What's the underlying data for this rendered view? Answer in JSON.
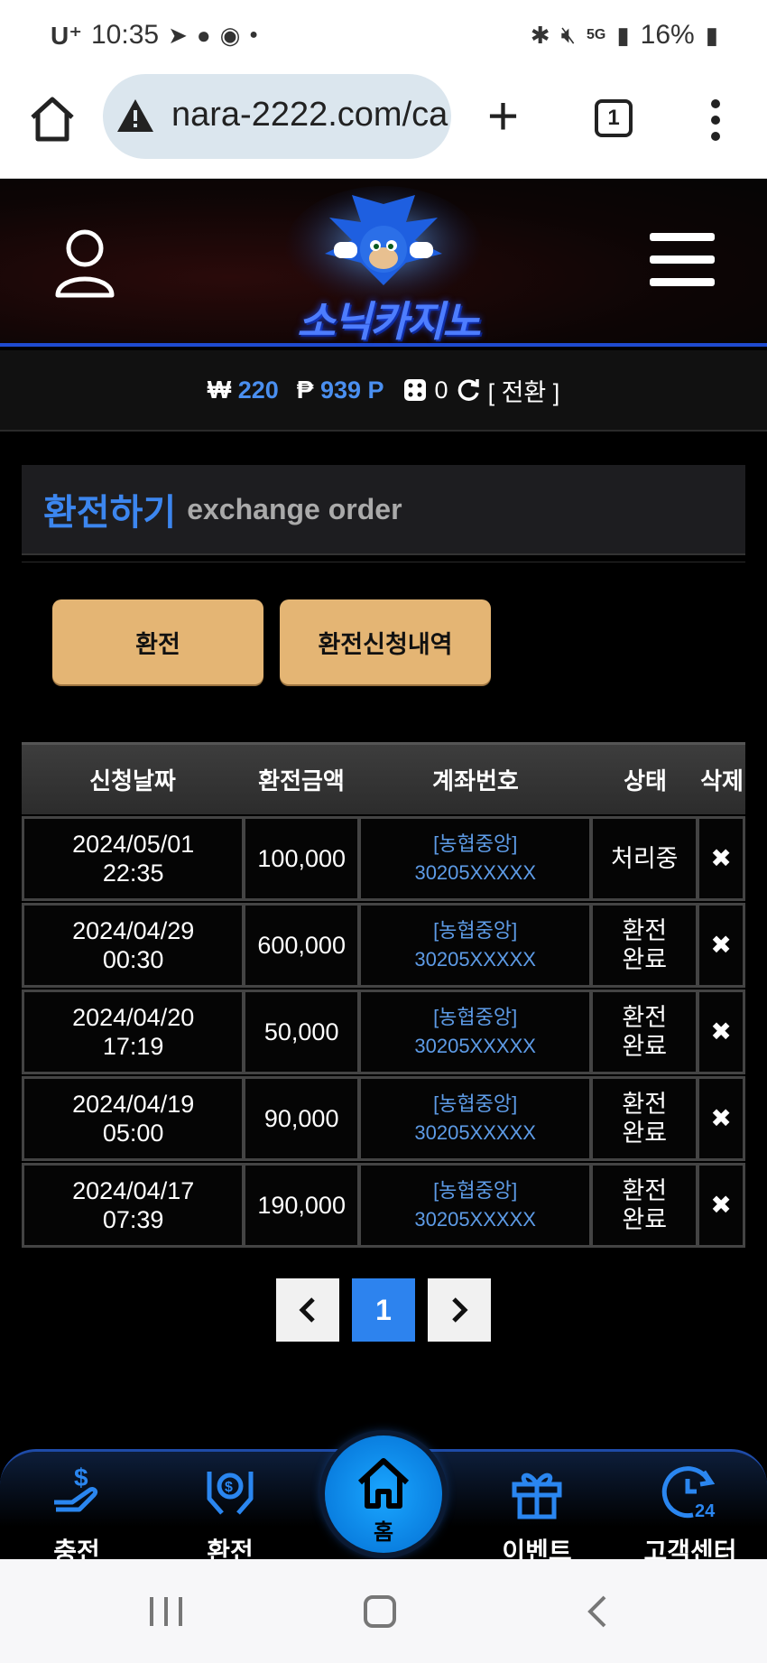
{
  "status_bar": {
    "carrier": "U⁺",
    "time": "10:35",
    "battery": "16%",
    "network": "5G"
  },
  "browser": {
    "url": "nara-2222.com/ca",
    "tab_count": "1"
  },
  "header": {
    "logo_text": "소닉카지노"
  },
  "balance": {
    "won_symbol": "₩",
    "won_value": "220",
    "point_symbol": "₱",
    "point_value": "939 P",
    "chip_value": "0",
    "switch_label": "[ 전환 ]"
  },
  "section": {
    "title_ko": "환전하기",
    "title_en": "exchange order"
  },
  "buttons": {
    "exchange": "환전",
    "history": "환전신청내역"
  },
  "table": {
    "headers": [
      "신청날짜",
      "환전금액",
      "계좌번호",
      "상태",
      "삭제"
    ],
    "rows": [
      {
        "date": "2024/05/01",
        "time": "22:35",
        "amount": "100,000",
        "bank": "[농협중앙]",
        "account": "30205XXXXX",
        "status": "처리중",
        "delete": "✖"
      },
      {
        "date": "2024/04/29",
        "time": "00:30",
        "amount": "600,000",
        "bank": "[농협중앙]",
        "account": "30205XXXXX",
        "status": "환전완료",
        "delete": "✖"
      },
      {
        "date": "2024/04/20",
        "time": "17:19",
        "amount": "50,000",
        "bank": "[농협중앙]",
        "account": "30205XXXXX",
        "status": "환전완료",
        "delete": "✖"
      },
      {
        "date": "2024/04/19",
        "time": "05:00",
        "amount": "90,000",
        "bank": "[농협중앙]",
        "account": "30205XXXXX",
        "status": "환전완료",
        "delete": "✖"
      },
      {
        "date": "2024/04/17",
        "time": "07:39",
        "amount": "190,000",
        "bank": "[농협중앙]",
        "account": "30205XXXXX",
        "status": "환전완료",
        "delete": "✖"
      }
    ]
  },
  "pagination": {
    "prev": "‹",
    "current": "1",
    "next": "›"
  },
  "bottom_nav": {
    "deposit": "충전",
    "exchange": "환전",
    "home": "홈",
    "event": "이벤트",
    "support": "고객센터"
  },
  "colors": {
    "accent_blue": "#3c86ef",
    "gold_button": "#e4b574",
    "background": "#000000"
  }
}
